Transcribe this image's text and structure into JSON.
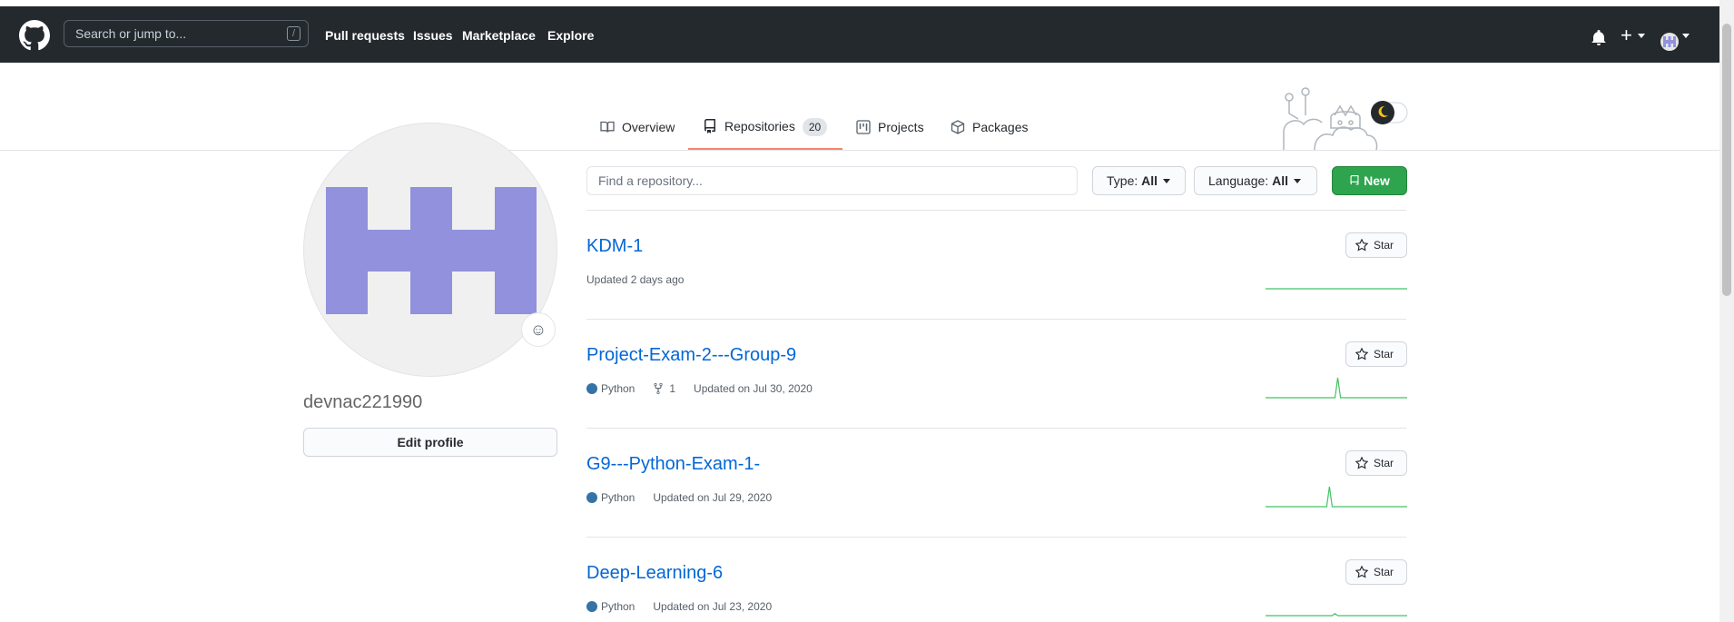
{
  "header": {
    "search_placeholder": "Search or jump to...",
    "search_shortcut": "/",
    "nav": [
      "Pull requests",
      "Issues",
      "Marketplace",
      "Explore"
    ],
    "plus_label": "+"
  },
  "tabs": [
    {
      "label": "Overview",
      "icon": "book-icon"
    },
    {
      "label": "Repositories",
      "icon": "repo-icon",
      "count": "20",
      "active": true
    },
    {
      "label": "Projects",
      "icon": "project-icon"
    },
    {
      "label": "Packages",
      "icon": "package-icon"
    }
  ],
  "profile": {
    "username": "devnac221990",
    "edit_label": "Edit profile",
    "avatar_color": "#9191dd"
  },
  "filters": {
    "find_placeholder": "Find a repository...",
    "type_label": "Type:",
    "type_value": "All",
    "language_label": "Language:",
    "language_value": "All",
    "new_label": "New"
  },
  "repos": [
    {
      "name": "KDM-1",
      "language": "",
      "forks": "",
      "updated": "Updated 2 days ago",
      "star_label": "Star",
      "activity": [
        0,
        0,
        0,
        0,
        0,
        0,
        0,
        0,
        0,
        0,
        0,
        0,
        0,
        0,
        0,
        0,
        0,
        0,
        0,
        0,
        0,
        0,
        0,
        0,
        0,
        0,
        0,
        0,
        0,
        0,
        0,
        0,
        0,
        0,
        0,
        0,
        0,
        0,
        0,
        0,
        0,
        0,
        0,
        0,
        0,
        0,
        0,
        0,
        0,
        0,
        0,
        0
      ]
    },
    {
      "name": "Project-Exam-2---Group-9",
      "language": "Python",
      "forks": "1",
      "updated": "Updated on Jul 30, 2020",
      "star_label": "Star",
      "activity": [
        0,
        0,
        0,
        0,
        0,
        0,
        0,
        0,
        0,
        0,
        0,
        0,
        0,
        0,
        0,
        0,
        0,
        0,
        0,
        0,
        0,
        0,
        0,
        0,
        0,
        0,
        1,
        0,
        0,
        0,
        0,
        0,
        0,
        0,
        0,
        0,
        0,
        0,
        0,
        0,
        0,
        0,
        0,
        0,
        0,
        0,
        0,
        0,
        0,
        0,
        0,
        0
      ]
    },
    {
      "name": "G9---Python-Exam-1-",
      "language": "Python",
      "forks": "",
      "updated": "Updated on Jul 29, 2020",
      "star_label": "Star",
      "activity": [
        0,
        0,
        0,
        0,
        0,
        0,
        0,
        0,
        0,
        0,
        0,
        0,
        0,
        0,
        0,
        0,
        0,
        0,
        0,
        0,
        0,
        0,
        0,
        1,
        0,
        0,
        0,
        0,
        0,
        0,
        0,
        0,
        0,
        0,
        0,
        0,
        0,
        0,
        0,
        0,
        0,
        0,
        0,
        0,
        0,
        0,
        0,
        0,
        0,
        0,
        0,
        0
      ]
    },
    {
      "name": "Deep-Learning-6",
      "language": "Python",
      "forks": "",
      "updated": "Updated on Jul 23, 2020",
      "star_label": "Star",
      "activity": [
        0,
        0,
        0,
        0,
        0,
        0,
        0,
        0,
        0,
        0,
        0,
        0,
        0,
        0,
        0,
        0,
        0,
        0,
        0,
        0,
        0,
        0,
        0,
        0,
        0,
        0.1,
        0,
        0,
        0,
        0,
        0,
        0,
        0,
        0,
        0,
        0,
        0,
        0,
        0,
        0,
        0,
        0,
        0,
        0,
        0,
        0,
        0,
        0,
        0,
        0,
        0,
        0
      ]
    }
  ],
  "colors": {
    "python": "#3572A5",
    "link": "#0366d6",
    "spark": "#40c463",
    "new_button": "#2ea44f"
  }
}
